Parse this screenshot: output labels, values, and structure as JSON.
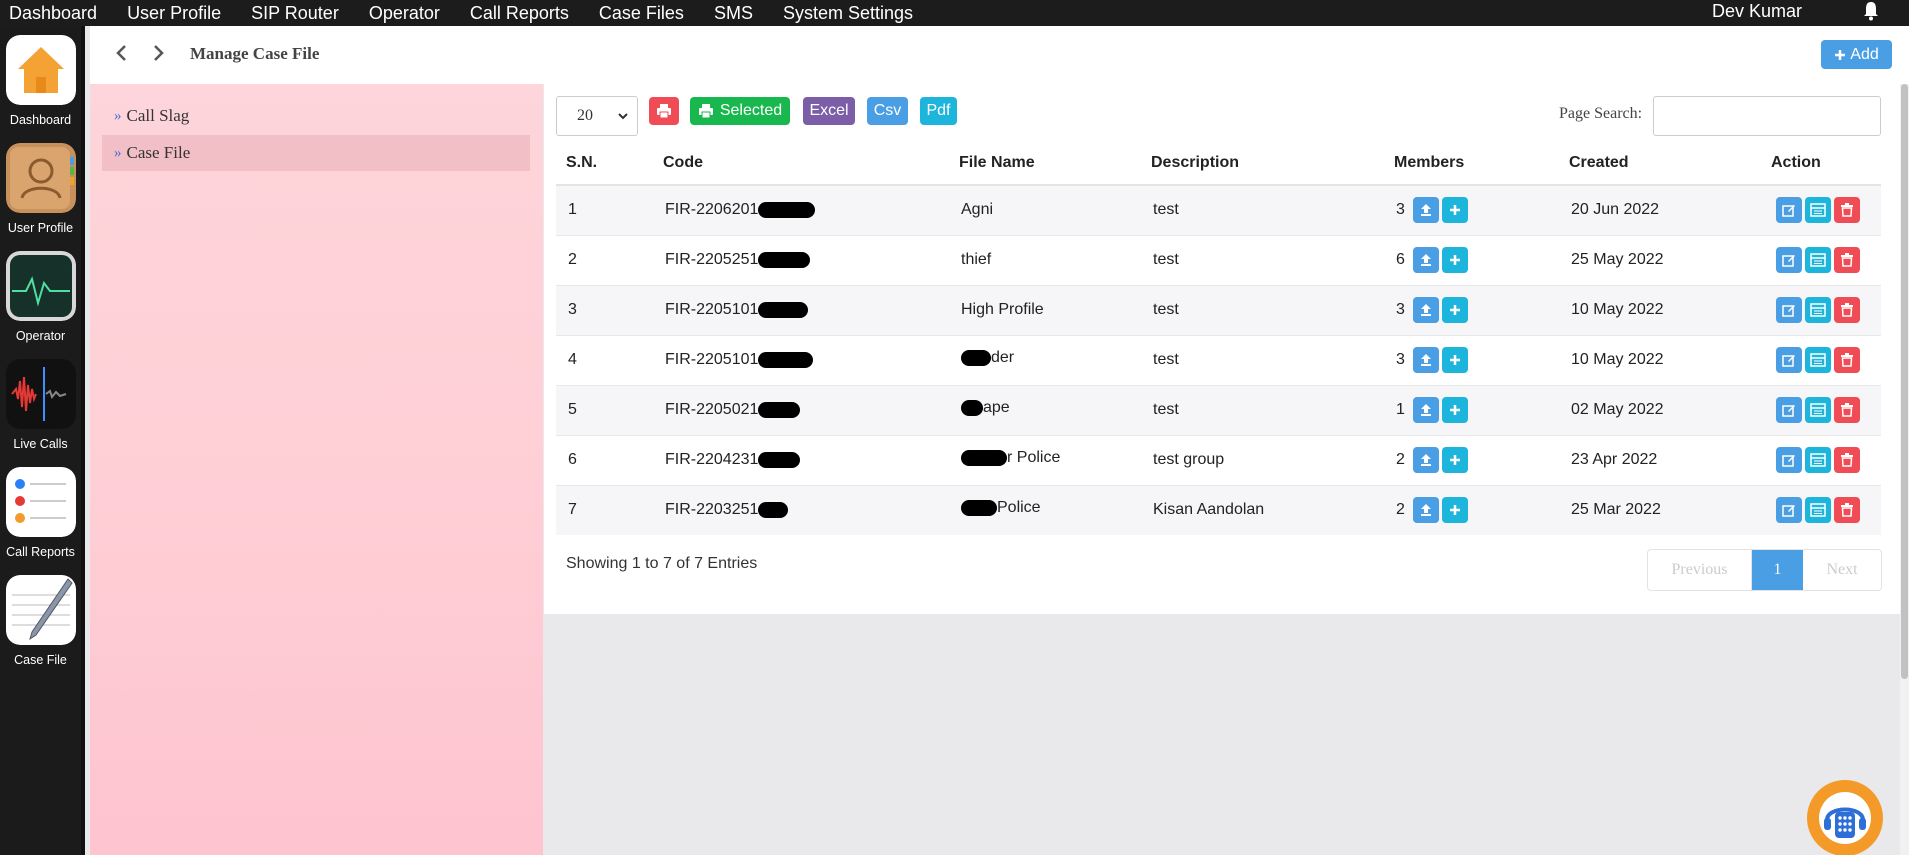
{
  "topbar": {
    "menu": [
      "Dashboard",
      "User Profile",
      "SIP Router",
      "Operator",
      "Call Reports",
      "Case Files",
      "SMS",
      "System Settings"
    ],
    "user_name": "Dev Kumar",
    "bell_icon": "bell-icon"
  },
  "dock": {
    "items": [
      {
        "label": "Dashboard",
        "icon": "home-icon"
      },
      {
        "label": "User Profile",
        "icon": "contacts-icon"
      },
      {
        "label": "Operator",
        "icon": "activity-monitor-icon"
      },
      {
        "label": "Live Calls",
        "icon": "voice-wave-icon"
      },
      {
        "label": "Call Reports",
        "icon": "reminders-list-icon"
      },
      {
        "label": "Case File",
        "icon": "notepad-pencil-icon"
      }
    ]
  },
  "header": {
    "title": "Manage Case File",
    "add_label": "Add"
  },
  "sidebar": {
    "items": [
      {
        "label": "Call Slag",
        "active": false
      },
      {
        "label": "Case File",
        "active": true
      }
    ]
  },
  "toolbar": {
    "page_size": "20",
    "selected_label": "Selected",
    "excel_label": "Excel",
    "csv_label": "Csv",
    "pdf_label": "Pdf",
    "search_label": "Page Search:"
  },
  "table": {
    "headers": [
      "S.N.",
      "Code",
      "File Name",
      "Description",
      "Members",
      "Created",
      "Action"
    ],
    "rows": [
      {
        "sn": "1",
        "code": "FIR-2206201",
        "name": "Agni",
        "desc": "test",
        "members": "3",
        "created": "20 Jun 2022"
      },
      {
        "sn": "2",
        "code": "FIR-2205251",
        "name": "thief",
        "desc": "test",
        "members": "6",
        "created": "25 May 2022"
      },
      {
        "sn": "3",
        "code": "FIR-2205101",
        "name": "High Profile",
        "desc": "test",
        "members": "3",
        "created": "10 May 2022"
      },
      {
        "sn": "4",
        "code": "FIR-2205101",
        "name": "der",
        "desc": "test",
        "members": "3",
        "created": "10 May 2022"
      },
      {
        "sn": "5",
        "code": "FIR-2205021",
        "name": "ape",
        "desc": "test",
        "members": "1",
        "created": "02 May 2022"
      },
      {
        "sn": "6",
        "code": "FIR-2204231",
        "name": "r Police",
        "desc": "test group",
        "members": "2",
        "created": "23 Apr 2022"
      },
      {
        "sn": "7",
        "code": "FIR-2203251",
        "name": " Police",
        "desc": "Kisan Aandolan",
        "members": "2",
        "created": "25 Mar 2022"
      }
    ]
  },
  "footer": {
    "showing": "Showing 1 to 7 of 7 Entries",
    "prev_label": "Previous",
    "current_page": "1",
    "next_label": "Next"
  },
  "colors": {
    "accent": "#4a9ee3",
    "danger": "#ef4c55",
    "success": "#18b84e",
    "excel": "#7b5ea7",
    "cyan": "#1eb5dc"
  }
}
